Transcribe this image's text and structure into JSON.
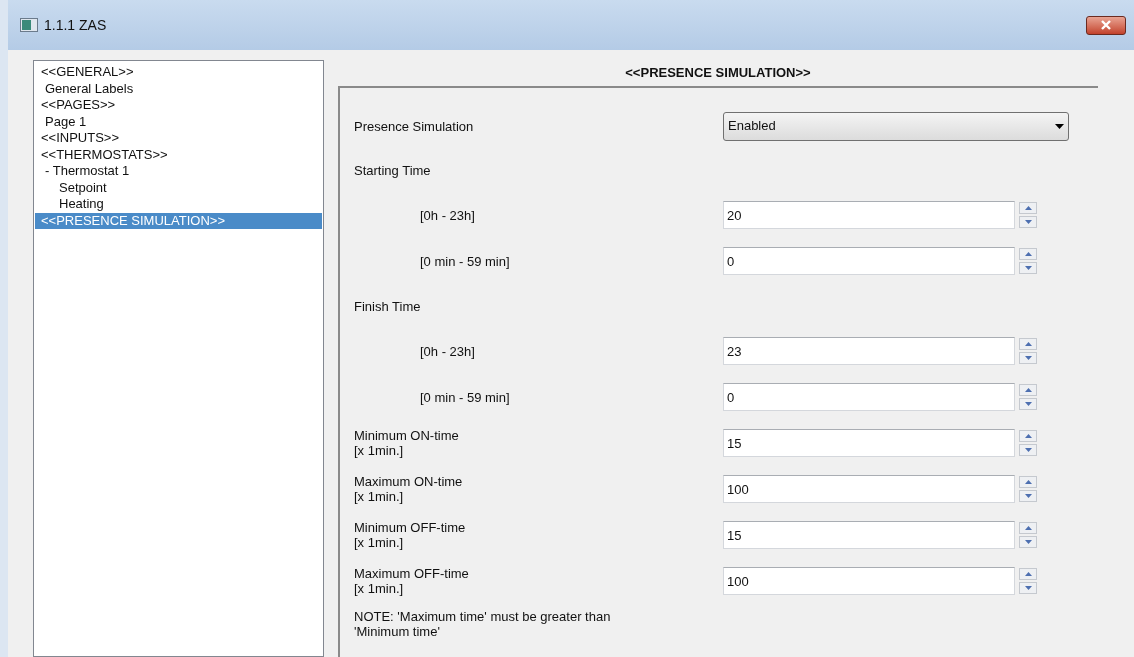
{
  "window": {
    "title": "1.1.1 ZAS"
  },
  "tree": [
    {
      "label": "<<GENERAL>>",
      "selected": false,
      "children": [
        {
          "label": "General Labels",
          "selected": false
        }
      ]
    },
    {
      "label": "<<PAGES>>",
      "selected": false,
      "children": [
        {
          "label": "Page 1",
          "selected": false
        }
      ]
    },
    {
      "label": "<<INPUTS>>",
      "selected": false
    },
    {
      "label": "<<THERMOSTATS>>",
      "selected": false,
      "children": [
        {
          "label": "- Thermostat 1",
          "selected": false,
          "children": [
            {
              "label": "Setpoint",
              "selected": false
            },
            {
              "label": "Heating",
              "selected": false
            }
          ]
        }
      ]
    },
    {
      "label": "<<PRESENCE SIMULATION>>",
      "selected": true
    }
  ],
  "panel": {
    "title": "<<PRESENCE SIMULATION>>",
    "rows": [
      {
        "kind": "dropdown",
        "label": "Presence Simulation",
        "value": "Enabled"
      },
      {
        "kind": "heading",
        "label": "Starting Time"
      },
      {
        "kind": "spin",
        "label": "[0h - 23h]",
        "value": "20"
      },
      {
        "kind": "spin",
        "label": "[0 min - 59 min]",
        "value": "0"
      },
      {
        "kind": "heading",
        "label": "Finish Time"
      },
      {
        "kind": "spin",
        "label": "[0h - 23h]",
        "value": "23"
      },
      {
        "kind": "spin",
        "label": "[0 min - 59 min]",
        "value": "0"
      },
      {
        "kind": "spin2",
        "label": "Minimum ON-time",
        "sublabel": "[x 1min.]",
        "value": "15"
      },
      {
        "kind": "spin2",
        "label": "Maximum ON-time",
        "sublabel": "[x 1min.]",
        "value": "100"
      },
      {
        "kind": "spin2",
        "label": "Minimum OFF-time",
        "sublabel": "[x 1min.]",
        "value": "15"
      },
      {
        "kind": "spin2",
        "label": "Maximum OFF-time",
        "sublabel": "[x 1min.]",
        "value": "100"
      },
      {
        "kind": "note",
        "label": "NOTE: 'Maximum time' must be greater than 'Minimum time'"
      }
    ]
  }
}
